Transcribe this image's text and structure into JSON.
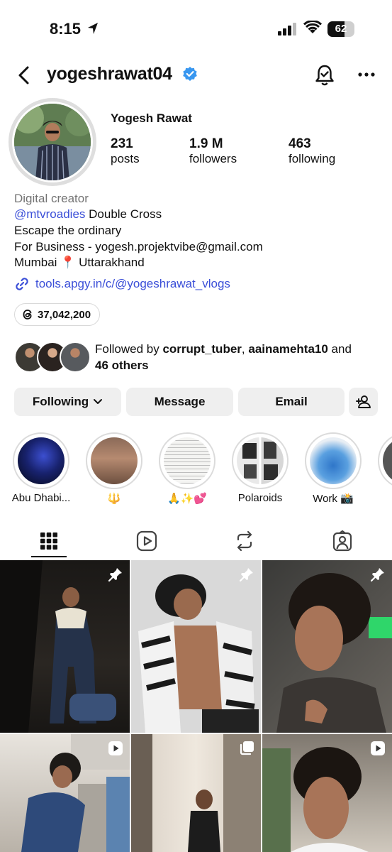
{
  "status_bar": {
    "time": "8:15",
    "battery": "62"
  },
  "header": {
    "username": "yogeshrawat04"
  },
  "profile": {
    "full_name": "Yogesh Rawat",
    "stats": [
      {
        "value": "231",
        "label": "posts"
      },
      {
        "value": "1.9 M",
        "label": "followers"
      },
      {
        "value": "463",
        "label": "following"
      }
    ],
    "category": "Digital creator",
    "bio": {
      "mention": "@mtvroadies",
      "mention_rest": " Double Cross",
      "line2": "Escape the ordinary",
      "line3": "For Business - yogesh.projektvibe@gmail.com",
      "line4": "Mumbai 📍 Uttarakhand"
    },
    "link": "tools.apgy.in/c/@yogeshrawat_vlogs",
    "threads_count": "37,042,200",
    "followed_by": {
      "prefix": "Followed by ",
      "user1": "corrupt_tuber",
      "sep": ", ",
      "user2": "aainamehta10",
      "and": " and",
      "others": "46 others"
    }
  },
  "actions": {
    "following": "Following",
    "message": "Message",
    "email": "Email"
  },
  "highlights": [
    {
      "label": "Abu Dhabi..."
    },
    {
      "label": "🔱"
    },
    {
      "label": "🙏✨💕"
    },
    {
      "label": "Polaroids"
    },
    {
      "label": "Work 📸"
    }
  ],
  "colors": {
    "link_blue": "#3b4fd8",
    "verified_blue": "#3897f0",
    "button_gray": "#efefef"
  },
  "icons": [
    "back-icon",
    "notification-bell-icon",
    "more-icon",
    "verified-badge-icon",
    "link-icon",
    "threads-icon",
    "add-person-icon",
    "grid-icon",
    "reels-icon",
    "reposts-icon",
    "tagged-icon",
    "pin-icon",
    "reel-badge-icon",
    "carousel-icon"
  ]
}
